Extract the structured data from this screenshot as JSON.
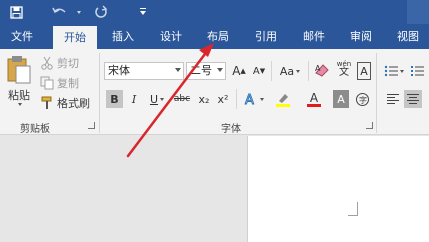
{
  "titlebar": {
    "save_icon": "save-icon",
    "undo_icon": "undo-icon",
    "redo_icon": "redo-icon",
    "customize_icon": "customize-qat-icon"
  },
  "tabs": [
    {
      "label": "文件"
    },
    {
      "label": "开始"
    },
    {
      "label": "插入"
    },
    {
      "label": "设计"
    },
    {
      "label": "布局"
    },
    {
      "label": "引用"
    },
    {
      "label": "邮件"
    },
    {
      "label": "审阅"
    },
    {
      "label": "视图"
    }
  ],
  "active_tab": "开始",
  "clipboard": {
    "paste_label": "粘贴",
    "cut_label": "剪切",
    "copy_label": "复制",
    "format_painter_label": "格式刷",
    "group_label": "剪贴板"
  },
  "font": {
    "font_name": "宋体",
    "font_size": "二号",
    "grow_label": "A",
    "shrink_label": "A",
    "case_label": "Aa",
    "phonetic_label": "wén",
    "bold": "B",
    "italic": "I",
    "underline": "U",
    "strike": "abc",
    "subscript": "x₂",
    "superscript": "x²",
    "group_label": "字体"
  },
  "colors": {
    "ribbon_blue": "#2b579a",
    "arrow_red": "#d9262c",
    "highlight_yellow": "#ffff00",
    "font_color_red": "#e01c1c"
  }
}
